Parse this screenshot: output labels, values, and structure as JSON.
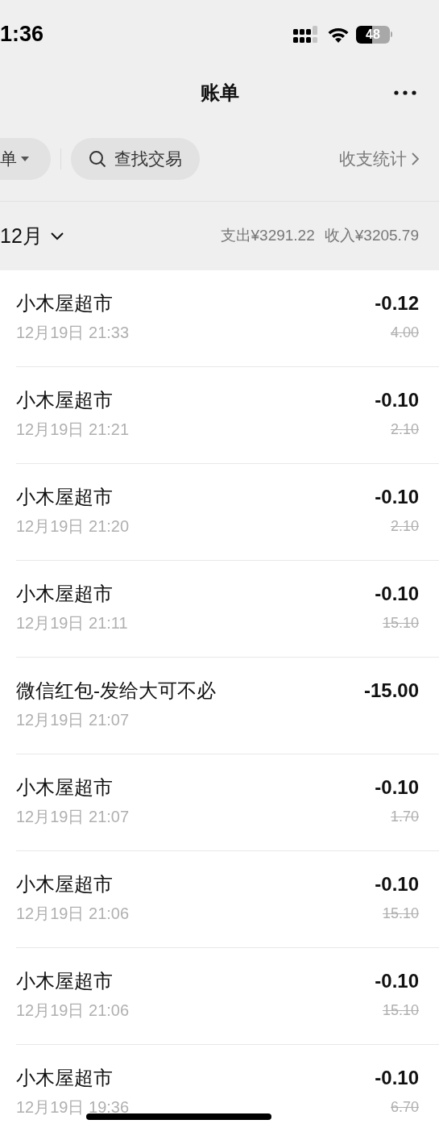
{
  "status_bar": {
    "time": "1:36",
    "battery": "48"
  },
  "nav": {
    "title": "账单"
  },
  "filters": {
    "type_pill": "单",
    "search": "查找交易",
    "stats_link": "收支统计"
  },
  "month_header": {
    "month": "12月",
    "expense": "支出¥3291.22",
    "income": "收入¥3205.79"
  },
  "transactions": [
    {
      "title": "小木屋超市",
      "time": "12月19日 21:33",
      "amount": "-0.12",
      "original": "4.00"
    },
    {
      "title": "小木屋超市",
      "time": "12月19日 21:21",
      "amount": "-0.10",
      "original": "2.10"
    },
    {
      "title": "小木屋超市",
      "time": "12月19日 21:20",
      "amount": "-0.10",
      "original": "2.10"
    },
    {
      "title": "小木屋超市",
      "time": "12月19日 21:11",
      "amount": "-0.10",
      "original": "15.10"
    },
    {
      "title": "微信红包-发给大可不必",
      "time": "12月19日 21:07",
      "amount": "-15.00"
    },
    {
      "title": "小木屋超市",
      "time": "12月19日 21:07",
      "amount": "-0.10",
      "original": "1.70"
    },
    {
      "title": "小木屋超市",
      "time": "12月19日 21:06",
      "amount": "-0.10",
      "original": "15.10"
    },
    {
      "title": "小木屋超市",
      "time": "12月19日 21:06",
      "amount": "-0.10",
      "original": "15.10"
    },
    {
      "title": "小木屋超市",
      "time": "12月19日 19:36",
      "amount": "-0.10",
      "original": "6.70"
    }
  ]
}
